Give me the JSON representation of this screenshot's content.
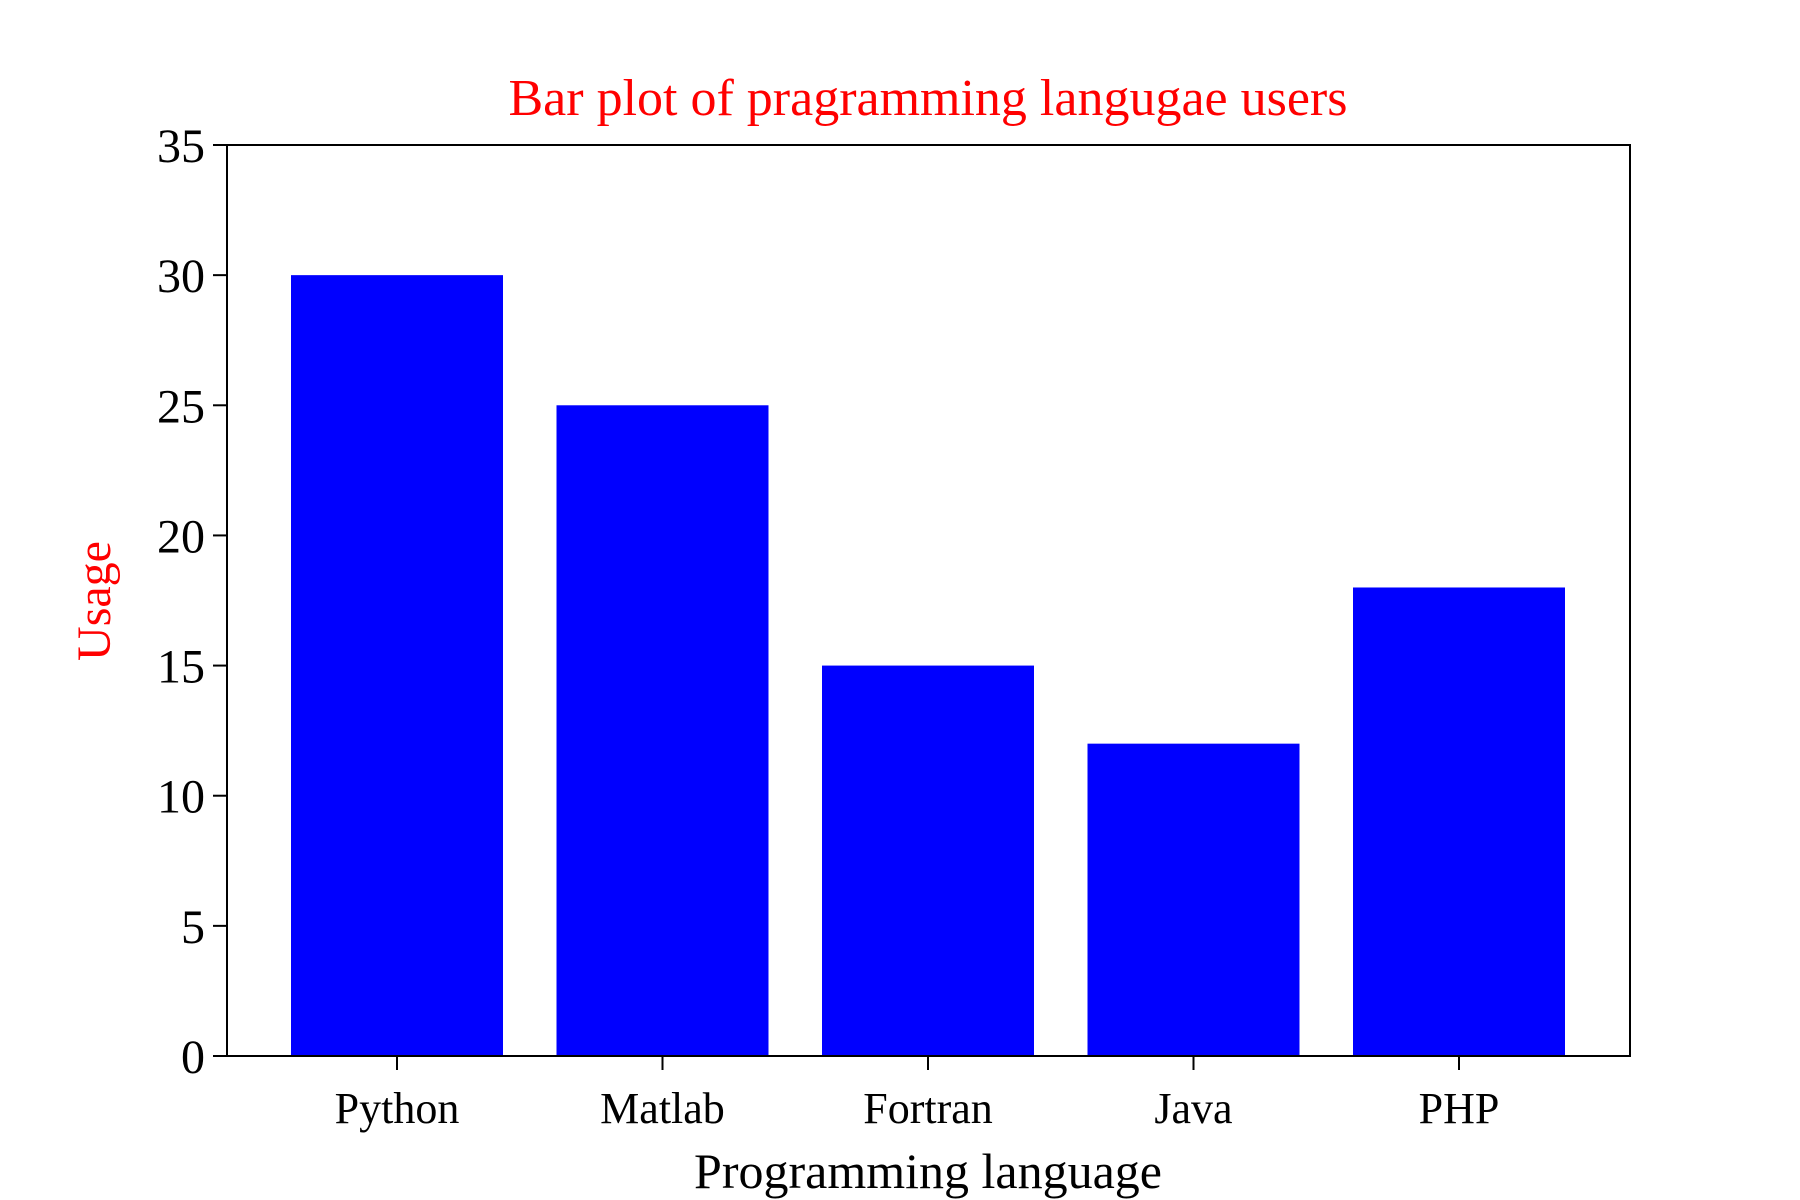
{
  "chart_data": {
    "type": "bar",
    "title": "Bar plot of pragramming langugae users",
    "xlabel": "Programming language",
    "ylabel": "Usage",
    "categories": [
      "Python",
      "Matlab",
      "Fortran",
      "Java",
      "PHP"
    ],
    "values": [
      30,
      25,
      15,
      12,
      18
    ],
    "ylim": [
      0,
      35
    ],
    "yticks": [
      "0",
      "5",
      "10",
      "15",
      "20",
      "25",
      "30",
      "35"
    ],
    "grid": false,
    "legend": "none"
  },
  "colors": {
    "bar": "#0000ff",
    "title": "#ff0000",
    "ylabel": "#ff0000",
    "xlabel": "#000000",
    "axes": "#000000"
  }
}
